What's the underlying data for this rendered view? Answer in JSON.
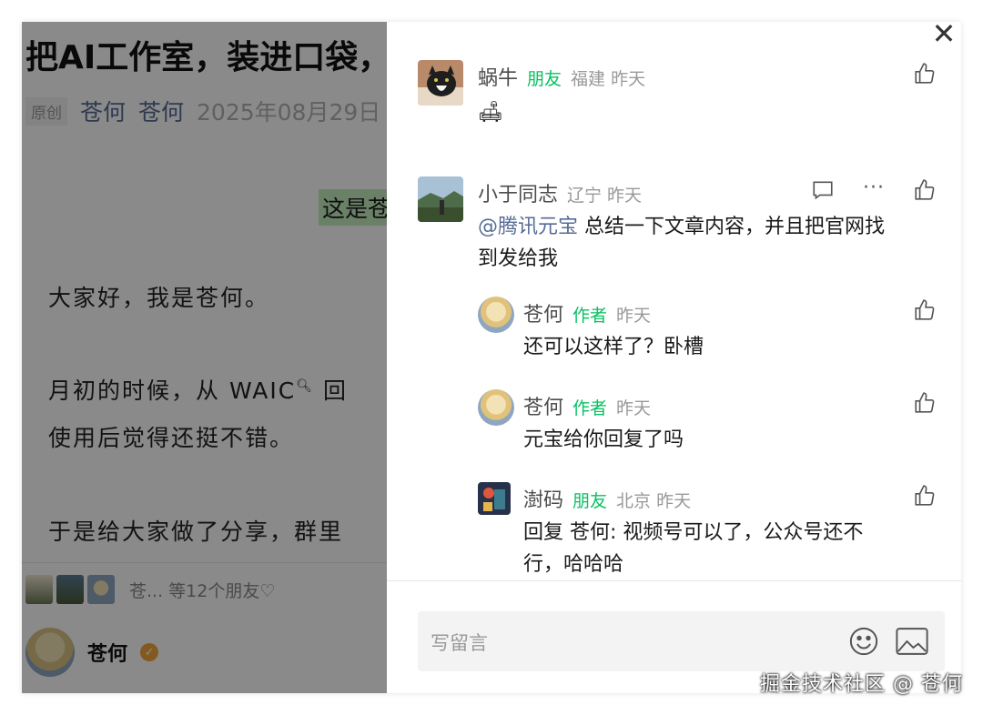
{
  "article": {
    "title": "把AI工作室，装进口袋，",
    "original_tag": "原创",
    "author_1": "苍何",
    "author_2": "苍何",
    "date": "2025年08月29日",
    "highlight": "这是苍",
    "para1": "大家好，我是苍何。",
    "para2_prefix": "月初的时候，从 WAIC",
    "para2_suffix": " 回",
    "para2_line2": "使用后觉得还挺不错。",
    "para3": "于是给大家做了分享，群里",
    "likers_text": "苍... 等12个朋友♡",
    "footer_author": "苍何"
  },
  "comments": [
    {
      "name": "蜗牛",
      "tag": "朋友",
      "meta": "福建  昨天",
      "body": "🛋",
      "avatar_icon": "cat-avatar"
    },
    {
      "name": "小于同志",
      "meta": "辽宁  昨天",
      "mention": "@腾讯元宝",
      "body_line1": " 总结一下文章内容，并且把官网找",
      "body_line2": "到发给我",
      "more": "···",
      "replies": [
        {
          "name": "苍何",
          "tag": "作者",
          "meta": "昨天",
          "body": "还可以这样了？卧槽"
        },
        {
          "name": "苍何",
          "tag": "作者",
          "meta": "昨天",
          "body": "元宝给你回复了吗"
        },
        {
          "name": "澍码",
          "tag": "朋友",
          "meta": "北京  昨天",
          "reply_prefix": "回复 ",
          "reply_to": "苍何",
          "body_line1": ": 视频号可以了，公众号还不",
          "body_line2": "行，哈哈哈"
        }
      ]
    }
  ],
  "input": {
    "placeholder": "写留言"
  },
  "close_glyph": "✕",
  "watermark": "掘金技术社区 @ 苍何",
  "colors": {
    "friend_tag": "#07c160",
    "mention": "#576b95",
    "highlight_bg": "#c4efc0"
  }
}
